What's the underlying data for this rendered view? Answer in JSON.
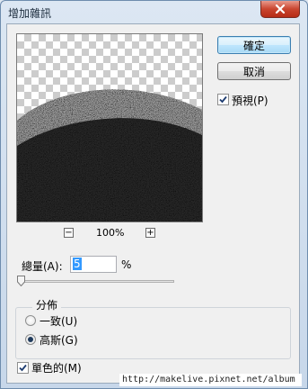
{
  "window": {
    "title": "增加雜訊"
  },
  "buttons": {
    "ok": "確定",
    "cancel": "取消"
  },
  "preview_toggle": {
    "label": "預視(P)",
    "checked": true
  },
  "zoom": {
    "minus": "−",
    "plus": "+",
    "level": "100%"
  },
  "amount": {
    "label": "總量(A):",
    "value": "5",
    "unit": "%",
    "slider_fraction": 0.01
  },
  "distribution": {
    "title": "分佈",
    "uniform": {
      "label": "一致(U)",
      "selected": false
    },
    "gaussian": {
      "label": "高斯(G)",
      "selected": true
    }
  },
  "monochromatic": {
    "label": "單色的(M)",
    "checked": true
  },
  "watermark": "http://makelive.pixnet.net/album",
  "icons": {
    "close": "close-icon",
    "check": "checkmark-icon"
  }
}
